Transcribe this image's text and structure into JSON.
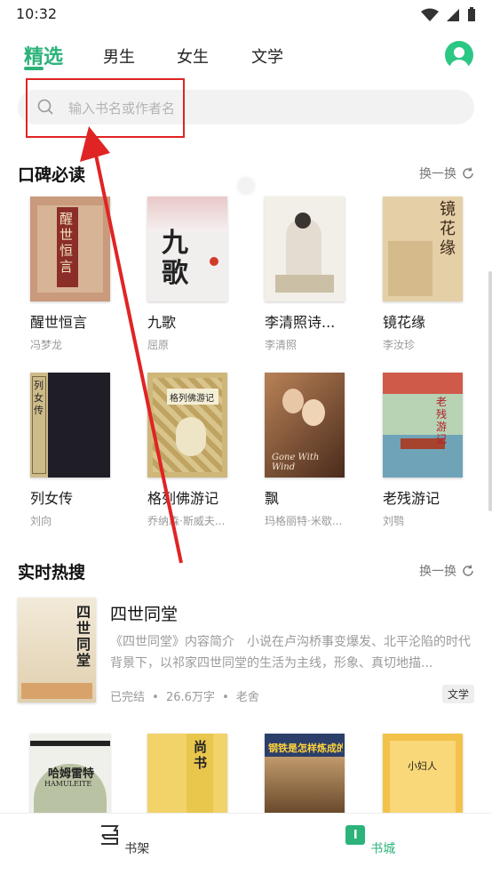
{
  "status_bar": {
    "time": "10:32"
  },
  "tabs": [
    {
      "label": "精选",
      "active": true
    },
    {
      "label": "男生"
    },
    {
      "label": "女生"
    },
    {
      "label": "文学"
    }
  ],
  "search": {
    "placeholder": "输入书名或作者名"
  },
  "section_recommend": {
    "title": "口碑必读",
    "refresh_label": "换一换",
    "books": [
      {
        "title": "醒世恒言",
        "author": "冯梦龙",
        "cover_text": "醒世恒言"
      },
      {
        "title": "九歌",
        "author": "屈原",
        "cover_text": "九歌"
      },
      {
        "title": "李清照诗...",
        "author": "李清照"
      },
      {
        "title": "镜花缘",
        "author": "李汝珍",
        "cover_text": "镜花缘"
      },
      {
        "title": "列女传",
        "author": "刘向",
        "cover_text": "列女传"
      },
      {
        "title": "格列佛游记",
        "author": "乔纳森·斯威夫...",
        "cover_text": "格列佛游记"
      },
      {
        "title": "飘",
        "author": "玛格丽特·米歇...",
        "cover_text": "Gone With Wind"
      },
      {
        "title": "老残游记",
        "author": "刘鹗",
        "cover_text": "老残游记"
      }
    ]
  },
  "section_hot": {
    "title": "实时热搜",
    "refresh_label": "换一换",
    "item": {
      "title": "四世同堂",
      "description": "《四世同堂》内容简介　小说在卢沟桥事变爆发、北平沦陷的时代背景下，以祁家四世同堂的生活为主线，形象、真切地描...",
      "status": "已完结",
      "word_count": "26.6万字",
      "author": "老舍",
      "tag": "文学",
      "cover_text": "四世同堂"
    },
    "more_books": [
      {
        "cover_text": "哈姆雷特",
        "cover_sub": "HAMULEITE"
      },
      {
        "cover_text": "尚书"
      },
      {
        "cover_text": "钢铁是怎样炼成的"
      },
      {
        "cover_text": "小妇人"
      }
    ]
  },
  "bottom_nav": [
    {
      "label": "书架"
    },
    {
      "label": "书城",
      "active": true
    }
  ],
  "colors": {
    "accent": "#2bb37a",
    "annotation": "#e02424"
  }
}
